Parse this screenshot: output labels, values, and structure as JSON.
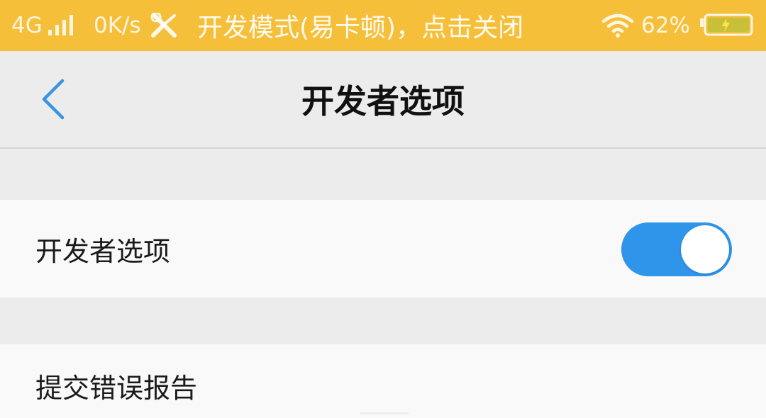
{
  "status_bar": {
    "network": "4G",
    "speed": "0K/s",
    "notice": "开发模式(易卡顿)，点击关闭",
    "battery_percent": "62%",
    "icons": [
      "signal-icon",
      "tools-icon",
      "wifi-icon",
      "battery-icon"
    ],
    "background_color": "#f5bf3a"
  },
  "header": {
    "title": "开发者选项",
    "back_icon": "chevron-left-icon",
    "accent_color": "#2f95ea"
  },
  "settings": {
    "developer_options": {
      "label": "开发者选项",
      "enabled": true
    },
    "submit_bug_report": {
      "label": "提交错误报告"
    }
  }
}
